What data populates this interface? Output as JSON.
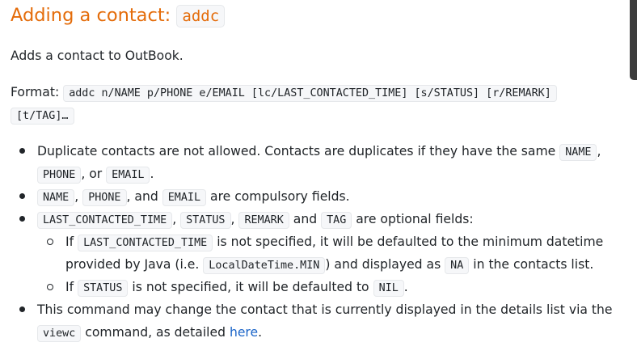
{
  "heading": {
    "text": "Adding a contact: ",
    "code": "addc"
  },
  "description": "Adds a contact to OutBook.",
  "format": {
    "label": "Format:",
    "code_line1": "addc n/NAME p/PHONE e/EMAIL [lc/LAST_CONTACTED_TIME] [s/STATUS] [r/REMARK]",
    "code_line2": "[t/TAG]…"
  },
  "bullets": {
    "b1": {
      "t1": "Duplicate contacts are not allowed. Contacts are duplicates if they have the same",
      "c1": "NAME",
      "t2": ",",
      "c2": "PHONE",
      "t3": ", or",
      "c3": "EMAIL",
      "t4": "."
    },
    "b2": {
      "c1": "NAME",
      "t1": ",",
      "c2": "PHONE",
      "t2": ", and",
      "c3": "EMAIL",
      "t3": "are compulsory fields."
    },
    "b3": {
      "c1": "LAST_CONTACTED_TIME",
      "t1": ",",
      "c2": "STATUS",
      "t2": ",",
      "c3": "REMARK",
      "t3": "and",
      "c4": "TAG",
      "t4": "are optional fields:",
      "sub1": {
        "t1": "If",
        "c1": "LAST_CONTACTED_TIME",
        "t2": "is not specified, it will be defaulted to the minimum datetime",
        "t3": "provided by Java (i.e.",
        "c2": "LocalDateTime.MIN",
        "t4": ") and displayed as",
        "c3": "NA",
        "t5": "in the contacts list."
      },
      "sub2": {
        "t1": "If",
        "c1": "STATUS",
        "t2": "is not specified, it will be defaulted to",
        "c2": "NIL",
        "t3": "."
      }
    },
    "b4": {
      "t1": "This command may change the contact that is currently displayed in the details list via the",
      "c1": "viewc",
      "t2": "command, as detailed",
      "link": "here",
      "t3": "."
    }
  },
  "colors": {
    "heading": "#e46c0a",
    "link": "#1a64c8",
    "code_bg": "#f6f7f9"
  }
}
